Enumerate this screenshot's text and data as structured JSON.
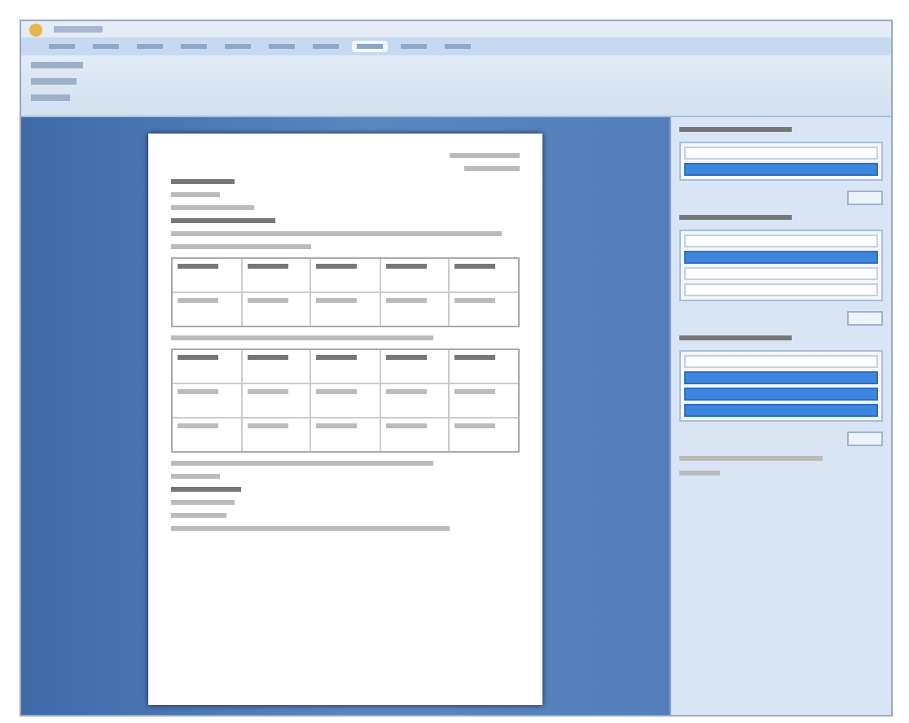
{
  "ribbon": {
    "tabs": [
      {
        "selected": false
      },
      {
        "selected": false
      },
      {
        "selected": false
      },
      {
        "selected": false
      },
      {
        "selected": false
      },
      {
        "selected": false
      },
      {
        "selected": false
      },
      {
        "selected": true
      },
      {
        "selected": false
      },
      {
        "selected": false
      }
    ]
  },
  "document": {
    "tables": [
      {
        "rows": [
          {
            "cells": [
              {
                "kind": "text"
              },
              {
                "kind": "text"
              },
              {
                "kind": "text"
              },
              {
                "kind": "text"
              },
              {
                "kind": "text"
              }
            ]
          },
          {
            "cells": [
              {
                "kind": "text"
              },
              {
                "kind": "text"
              },
              {
                "kind": "text"
              },
              {
                "kind": "text"
              },
              {
                "kind": "text"
              }
            ]
          }
        ]
      },
      {
        "rows": [
          {
            "cells": [
              {
                "kind": "text"
              },
              {
                "kind": "text"
              },
              {
                "kind": "text"
              },
              {
                "kind": "text"
              },
              {
                "kind": "text"
              }
            ]
          },
          {
            "cells": [
              {
                "kind": "text"
              },
              {
                "kind": "text"
              },
              {
                "kind": "text"
              },
              {
                "kind": "text"
              },
              {
                "kind": "text"
              }
            ]
          },
          {
            "cells": [
              {
                "kind": "text"
              },
              {
                "kind": "text"
              },
              {
                "kind": "text"
              },
              {
                "kind": "text"
              },
              {
                "kind": "text"
              }
            ]
          }
        ]
      }
    ]
  },
  "task_pane": {
    "lists": [
      {
        "rows": [
          {
            "selected": false
          },
          {
            "selected": true
          }
        ]
      },
      {
        "rows": [
          {
            "selected": false
          },
          {
            "selected": true
          },
          {
            "selected": false
          },
          {
            "selected": false
          }
        ]
      },
      {
        "rows": [
          {
            "selected": false
          },
          {
            "selected": true
          },
          {
            "selected": true
          },
          {
            "selected": true
          }
        ]
      }
    ]
  }
}
